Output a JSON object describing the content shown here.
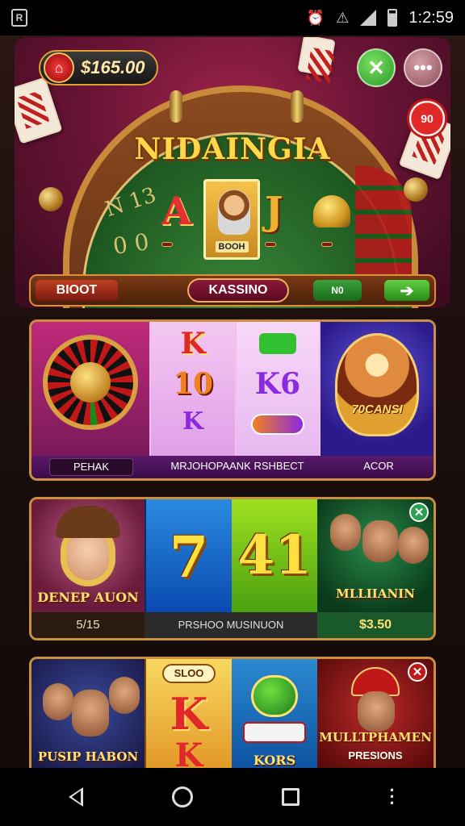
{
  "status_bar": {
    "time": "1:2:59"
  },
  "hero": {
    "balance": "$165.00",
    "title": "NIDAINGIA",
    "card_left": "A",
    "card_right": "J",
    "center_label": "BOOH",
    "chip_labels": [
      "",
      "",
      ""
    ],
    "digits_top": "N 13",
    "digits_bottom": "0 0",
    "chip_value": "90",
    "close_symbol": "✕",
    "more_symbol": "•••",
    "bar": {
      "left_label": "BIOOT",
      "center_tab": "KASSINO",
      "right_label": "N0",
      "go_symbol": "➔"
    }
  },
  "row1": {
    "slot1_symbols": [
      "K",
      "10",
      "K"
    ],
    "slot2_symbols": [
      "",
      "K6",
      ""
    ],
    "lady_top": "",
    "lady_title": "70CANSI",
    "labels": [
      "PEHAK",
      "MRJOHOPAANK RSHBECT",
      "ACOR"
    ]
  },
  "row2": {
    "cowgirl_title": "DENEP AUON",
    "seven": "7",
    "four": "41",
    "men_title": "MLLIIANIN",
    "labels": [
      "5/15",
      "PRSHOO MUSINUON",
      "$3.50"
    ]
  },
  "row3": {
    "group_title": "PUSIP HABON",
    "slot_top": "SLOO",
    "chips_text": "KORS",
    "hat_title": "MULLTPHAMEN",
    "hat_sub": "PRESIONS"
  },
  "colors": {
    "accent_gold": "#e0a030",
    "row_border": "#c89040",
    "green_button": "#3aa03a",
    "red_chip": "#e02828"
  },
  "icons": [
    "wifi-off-icon",
    "signal-icon",
    "battery-icon",
    "back-icon",
    "home-icon",
    "recents-icon",
    "overflow-icon"
  ]
}
